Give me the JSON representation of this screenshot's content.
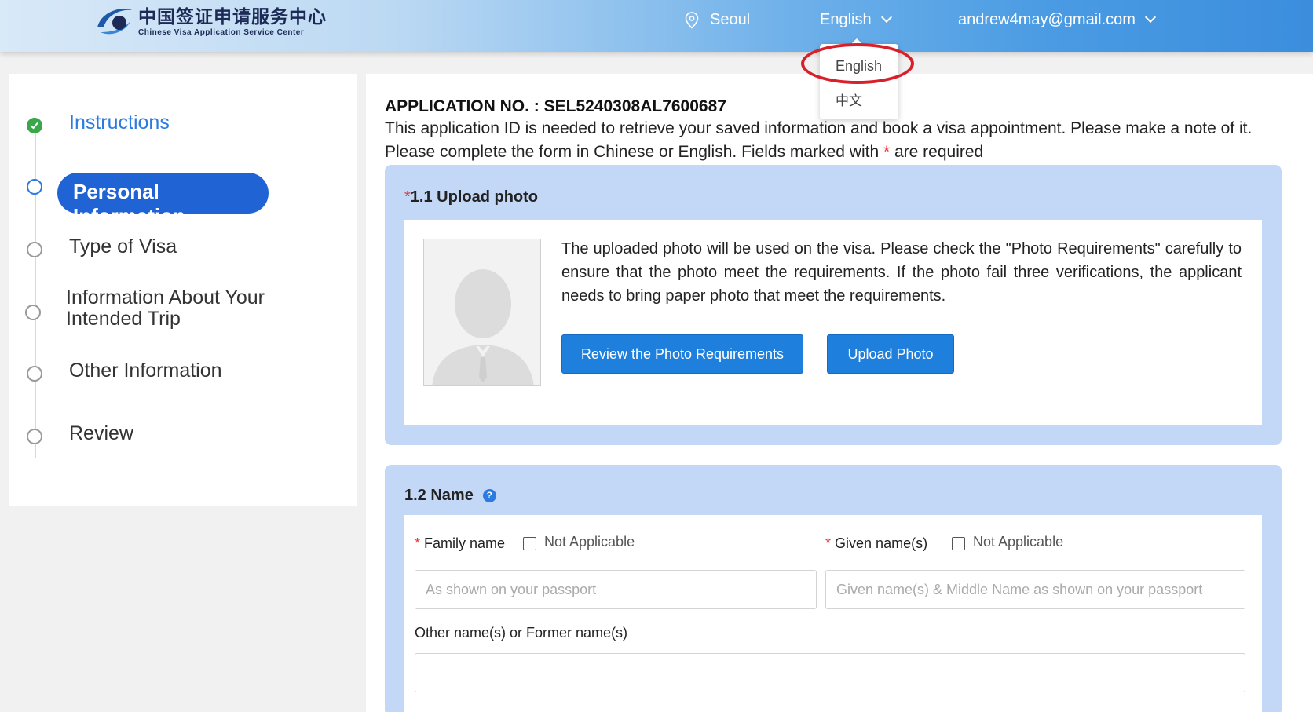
{
  "header": {
    "logo_cn": "中国签证申请服务中心",
    "logo_en": "Chinese Visa Application Service Center",
    "location": "Seoul",
    "language": "English",
    "user_email": "andrew4may@gmail.com"
  },
  "language_menu": {
    "options": [
      "English",
      "中文"
    ]
  },
  "sidebar": {
    "steps": [
      {
        "label": "Instructions",
        "state": "done"
      },
      {
        "label": "Personal Information",
        "state": "active"
      },
      {
        "label": "Type of Visa",
        "state": "pending"
      },
      {
        "label": "Information About Your",
        "label2": "Intended Trip",
        "state": "pending"
      },
      {
        "label": "Other Information",
        "state": "pending"
      },
      {
        "label": "Review",
        "state": "pending"
      }
    ]
  },
  "main": {
    "application_no": "APPLICATION NO. : SEL5240308AL7600687",
    "description": "This application ID is needed to retrieve your saved information and book a visa appointment. Please make a note of it.",
    "required_note_pre": "Please complete the form in Chinese or English. Fields marked with",
    "required_mark": "*",
    "required_note_post": "are required"
  },
  "upload_photo": {
    "required_mark": "*",
    "title": "1.1 Upload photo",
    "text": "The uploaded photo will be used on the visa. Please check the \"Photo Requirements\" carefully to ensure that the photo meet the requirements. If the photo fail three verifications, the applicant needs to bring paper photo that meet the requirements.",
    "review_button": "Review the Photo Requirements",
    "upload_button": "Upload Photo"
  },
  "name_section": {
    "title": "1.2 Name",
    "help_icon": "?",
    "required_mark": "*",
    "family_name_label": "Family name",
    "family_not_applicable": "Not Applicable",
    "family_placeholder": "As shown on your passport",
    "given_name_label": "Given name(s)",
    "given_not_applicable": "Not Applicable",
    "given_placeholder": "Given name(s) & Middle Name as shown on your passport",
    "other_names_label": "Other name(s) or Former name(s)",
    "other_names_value": ""
  },
  "colors": {
    "accent": "#2063d4",
    "button": "#1f7fdd",
    "section_bg": "#c3d7f7",
    "done": "#3aa84a",
    "highlight": "#d8202a"
  }
}
